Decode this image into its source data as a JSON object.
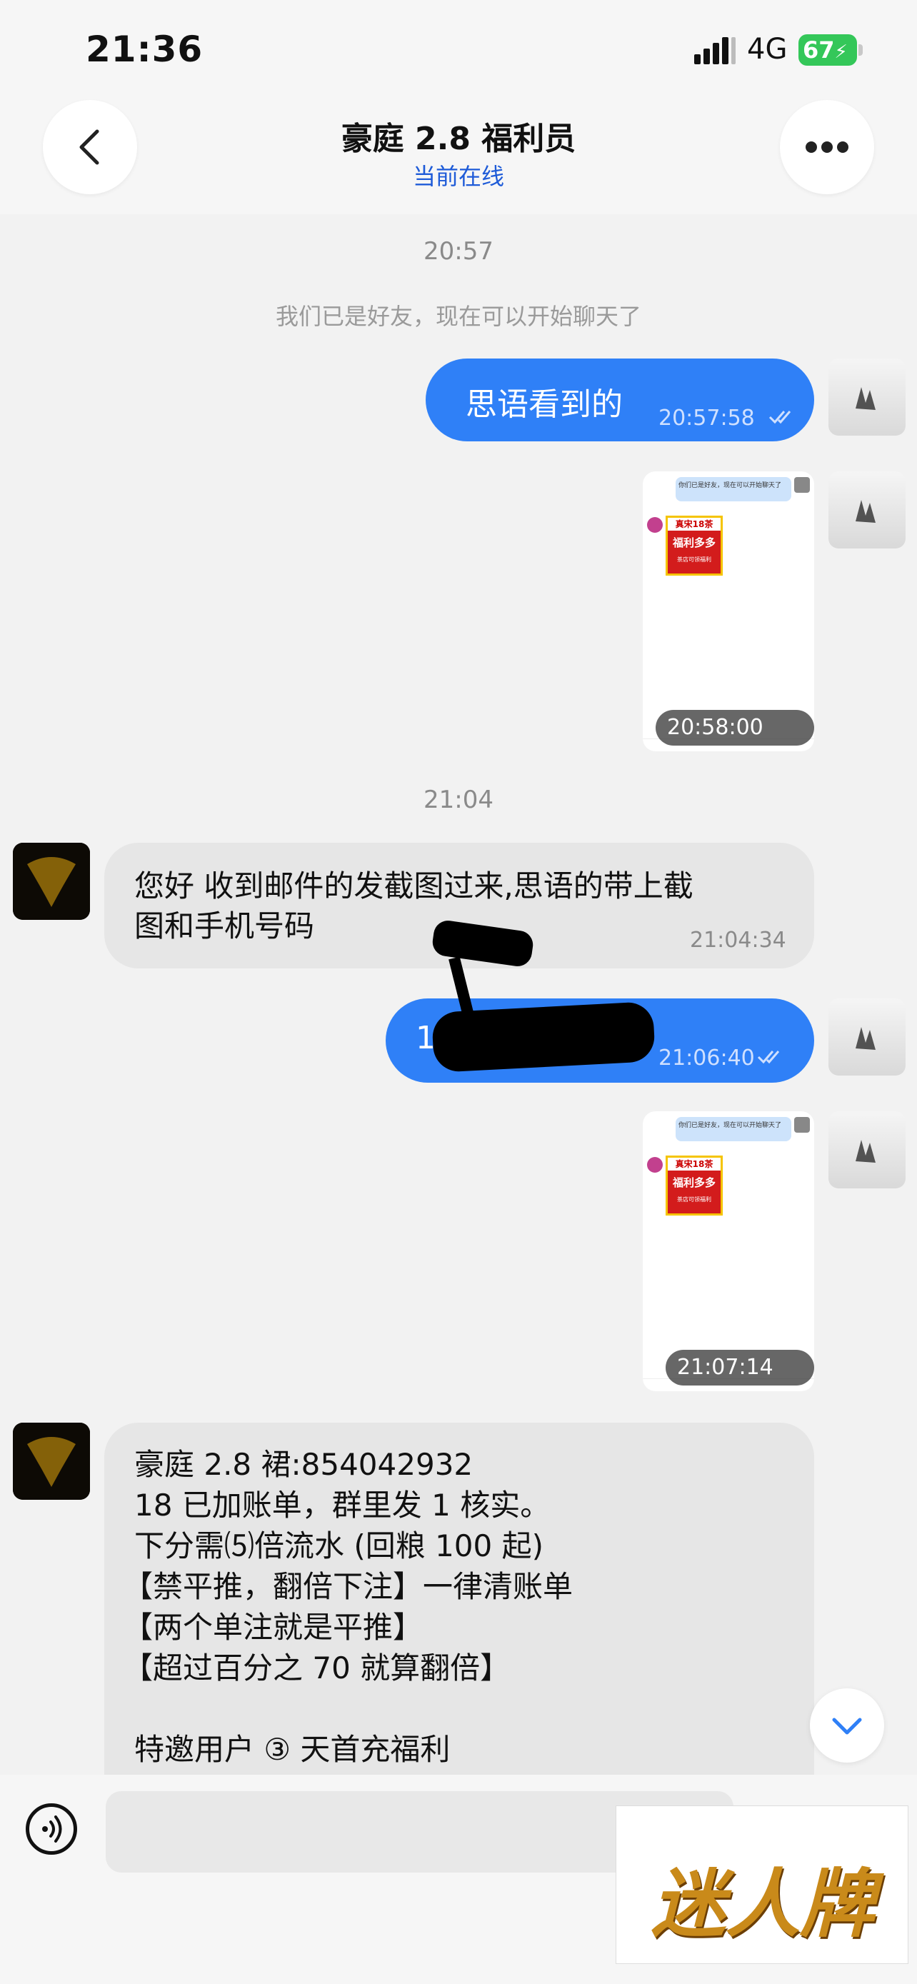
{
  "status_bar": {
    "time": "21:36",
    "network": "4G",
    "battery": "67"
  },
  "header": {
    "title": "豪庭 2.8 福利员",
    "subtitle": "当前在线"
  },
  "chat": {
    "time_1": "20:57",
    "system_note": "我们已是好友，现在可以开始聊天了",
    "msg_1": {
      "text": "思语看到的",
      "time": "20:57:58"
    },
    "img_1": {
      "time": "20:58:00",
      "thumb_bubble": "你们已是好友，现在可以开始聊天了",
      "thumb_poster_line1": "真宋18茶",
      "thumb_poster_line2": "福利多多",
      "thumb_poster_line3": "茶店可领福利"
    },
    "time_2": "21:04",
    "msg_2": {
      "text_line1": "您好 收到邮件的发截图过来,思语的带上截",
      "text_line2": "图和手机号码",
      "time": "21:04:34"
    },
    "msg_3": {
      "text": "15",
      "time": "21:06:40"
    },
    "img_2": {
      "time": "21:07:14",
      "thumb_bubble": "你们已是好友，现在可以开始聊天了",
      "thumb_poster_line1": "真宋18茶",
      "thumb_poster_line2": "福利多多",
      "thumb_poster_line3": "茶店可领福利"
    },
    "msg_4": {
      "lines": [
        "豪庭 2.8 裙:854042932",
        "18 已加账单，群里发 1 核实。",
        "下分需⑸倍流水 (回粮 100 起)",
        "【禁平推，翻倍下注】一律清账单",
        "【两个单注就是平推】",
        "【超过百分之 70 就算翻倍】",
        "",
        "特邀用户 ③ 天首充福利"
      ]
    }
  },
  "watermark": {
    "text": "迷人牌"
  },
  "icons": {
    "back": "chevron-left-icon",
    "more": "more-dots-icon",
    "voice": "voice-icon",
    "scroll": "chevron-down-icon",
    "read_receipt": "double-check-icon"
  },
  "colors": {
    "accent": "#2f80f7",
    "online": "#1e5bd8",
    "battery": "#34c759"
  }
}
